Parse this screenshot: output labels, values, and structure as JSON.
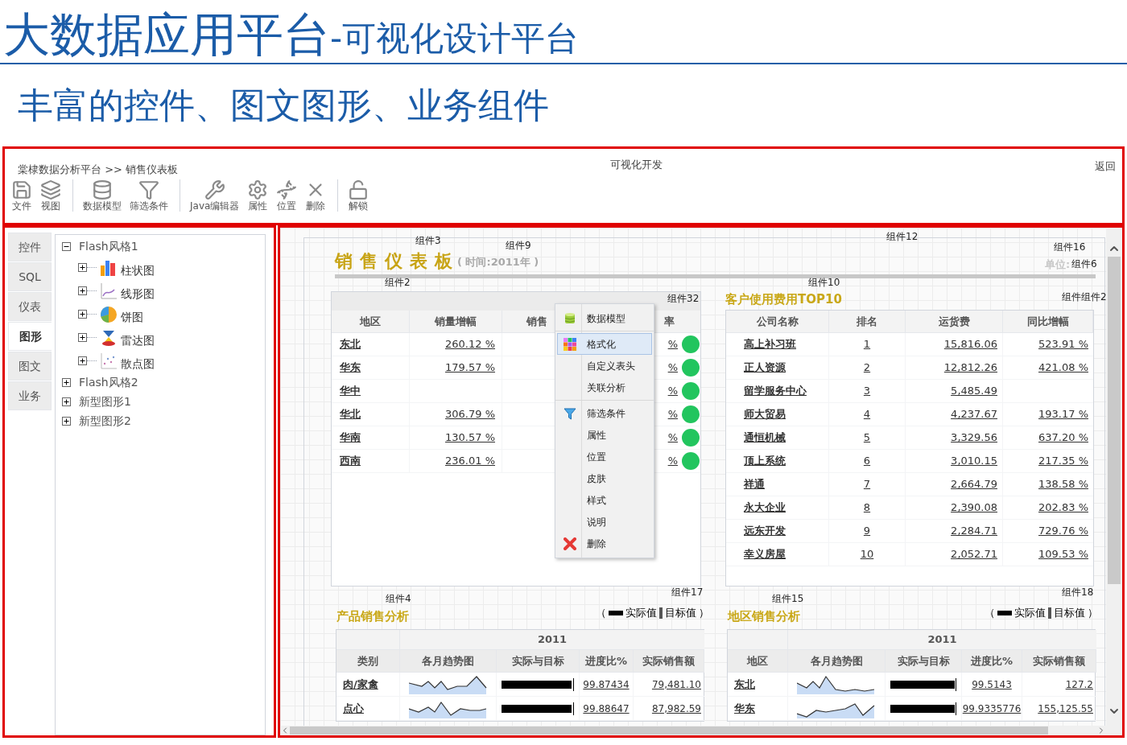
{
  "slide": {
    "title": "大数据应用平台",
    "title_suffix": "-可视化设计平台",
    "subtitle": "丰富的控件、图文图形、业务组件"
  },
  "toolbar": {
    "breadcrumb": "棠棣数据分析平台 >> 销售仪表板",
    "title": "可视化开发",
    "back": "返回",
    "groups": [
      [
        "文件",
        "视图"
      ],
      [
        "数据模型",
        "筛选条件"
      ],
      [
        "Java编辑器",
        "属性",
        "位置",
        "删除"
      ],
      [
        "解锁"
      ]
    ]
  },
  "sidebar": {
    "tabs": [
      {
        "label": "控件",
        "selected": false
      },
      {
        "label": "SQL",
        "selected": false
      },
      {
        "label": "仪表",
        "selected": false
      },
      {
        "label": "图形",
        "selected": true
      },
      {
        "label": "图文",
        "selected": false
      },
      {
        "label": "业务",
        "selected": false
      }
    ],
    "tree": [
      {
        "label": "Flash风格1",
        "expanded": true,
        "children": [
          {
            "label": "柱状图",
            "expanded": false
          },
          {
            "label": "线形图",
            "expanded": false
          },
          {
            "label": "饼图",
            "expanded": false
          },
          {
            "label": "雷达图",
            "expanded": false
          },
          {
            "label": "散点图",
            "expanded": false
          }
        ]
      },
      {
        "label": "Flash风格2",
        "expanded": false
      },
      {
        "label": "新型图形1",
        "expanded": false
      },
      {
        "label": "新型图形2",
        "expanded": false
      }
    ]
  },
  "dashboard": {
    "title": "销售仪表板",
    "period": "( 时间:2011年 )",
    "unit_label": "单位:",
    "component_labels": [
      "组件3",
      "组件9",
      "组件12",
      "组件16",
      "组件6",
      "组件2",
      "组件10",
      "组件32",
      "组件组件2",
      "组件4",
      "组件17",
      "组件15",
      "组件18"
    ]
  },
  "sales_table": {
    "columns": [
      "地区",
      "销量增幅",
      "销售",
      "率"
    ],
    "rows": [
      {
        "region": "东北",
        "growth": "260.12 %",
        "rate": "%",
        "color": "#22c55e"
      },
      {
        "region": "华东",
        "growth": "179.57 %",
        "rate": "%",
        "color": "#22c55e"
      },
      {
        "region": "华中",
        "rate": "%",
        "color": "#22c55e"
      },
      {
        "region": "华北",
        "growth": "306.79 %",
        "rate": "%",
        "color": "#22c55e"
      },
      {
        "region": "华南",
        "growth": "130.57 %",
        "rate": "%",
        "color": "#22c55e"
      },
      {
        "region": "西南",
        "growth": "236.01 %",
        "rate": "%",
        "color": "#22c55e"
      }
    ]
  },
  "context_menu": {
    "groups": [
      [
        {
          "label": "数据模型",
          "selected": false
        }
      ],
      [
        {
          "label": "格式化",
          "selected": true
        },
        {
          "label": "自定义表头",
          "selected": false
        },
        {
          "label": "关联分析",
          "selected": false
        }
      ],
      [
        {
          "label": "筛选条件",
          "selected": false
        },
        {
          "label": "属性",
          "selected": false
        },
        {
          "label": "位置",
          "selected": false
        },
        {
          "label": "皮肤",
          "selected": false
        },
        {
          "label": "样式",
          "selected": false
        },
        {
          "label": "说明",
          "selected": false
        },
        {
          "label": "删除",
          "selected": false
        }
      ]
    ]
  },
  "top10": {
    "title": "客户使用费用TOP10",
    "columns": [
      "公司名称",
      "排名",
      "运货费",
      "同比增幅"
    ],
    "rows": [
      {
        "company": "高上补习班",
        "rank": "1",
        "freight": "15,816.06",
        "growth": "523.91 %"
      },
      {
        "company": "正人资源",
        "rank": "2",
        "freight": "12,812.26",
        "growth": "421.08 %"
      },
      {
        "company": "留学服务中心",
        "rank": "3",
        "freight": "5,485.49"
      },
      {
        "company": "师大贸易",
        "rank": "4",
        "freight": "4,237.67",
        "growth": "193.17 %"
      },
      {
        "company": "通恒机械",
        "rank": "5",
        "freight": "3,329.56",
        "growth": "637.20 %"
      },
      {
        "company": "顶上系统",
        "rank": "6",
        "freight": "3,010.15",
        "growth": "217.35 %"
      },
      {
        "company": "祥通",
        "rank": "7",
        "freight": "2,664.79",
        "growth": "138.58 %"
      },
      {
        "company": "永大企业",
        "rank": "8",
        "freight": "2,390.08",
        "growth": "202.83 %"
      },
      {
        "company": "远东开发",
        "rank": "9",
        "freight": "2,284.71",
        "growth": "729.76 %"
      },
      {
        "company": "幸义房屋",
        "rank": "10",
        "freight": "2,052.71",
        "growth": "109.53 %"
      }
    ]
  },
  "analysis": [
    {
      "title": "产品销售分析",
      "legend": {
        "open": "（",
        "actual": "实际值",
        "target": "目标值",
        "close": "）"
      },
      "year": "2011",
      "columns": [
        "类别",
        "各月趋势图",
        "实际与目标",
        "进度比%",
        "实际销售额"
      ],
      "rows": [
        {
          "name": "肉/家禽",
          "level": 0.97,
          "progress": "99.87434",
          "sales": "79,481.10"
        },
        {
          "name": "点心",
          "level": 0.97,
          "progress": "99.88647",
          "sales": "87,982.59"
        }
      ]
    },
    {
      "title": "地区销售分析",
      "legend": {
        "open": "（",
        "actual": "实际值",
        "target": "目标值",
        "close": "）"
      },
      "year": "2011",
      "columns": [
        "地区",
        "各月趋势图",
        "实际与目标",
        "进度比%",
        "实际销售额"
      ],
      "rows": [
        {
          "name": "东北",
          "level": 0.97,
          "progress": "99.5143",
          "sales": "127.2"
        },
        {
          "name": "华东",
          "level": 0.97,
          "progress": "99.9335776",
          "sales": "155,125.55"
        }
      ]
    }
  ]
}
